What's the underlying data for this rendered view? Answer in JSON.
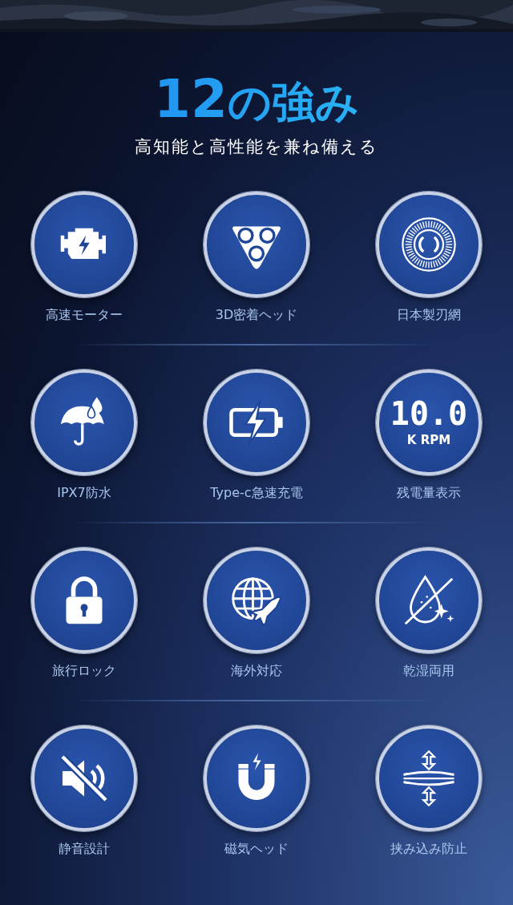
{
  "title": {
    "number": "12",
    "rest": "の強み"
  },
  "subtitle": "高知能と高性能を兼ね備える",
  "features": [
    {
      "kind": "motor",
      "label": "高速モーター"
    },
    {
      "kind": "head",
      "label": "3D密着ヘッド"
    },
    {
      "kind": "blade",
      "label": "日本製刃網"
    },
    {
      "kind": "umbrella",
      "label": "IPX7防水"
    },
    {
      "kind": "battery",
      "label": "Type-c急速充電"
    },
    {
      "kind": "rpm",
      "label": "残電量表示"
    },
    {
      "kind": "lock",
      "label": "旅行ロック"
    },
    {
      "kind": "globe",
      "label": "海外対応"
    },
    {
      "kind": "drop",
      "label": "乾湿両用"
    },
    {
      "kind": "mute",
      "label": "静音設計"
    },
    {
      "kind": "magnet",
      "label": "磁気ヘッド"
    },
    {
      "kind": "pinch",
      "label": "挟み込み防止"
    }
  ],
  "speed_display": {
    "reading": "10.0",
    "unit": "K RPM"
  }
}
